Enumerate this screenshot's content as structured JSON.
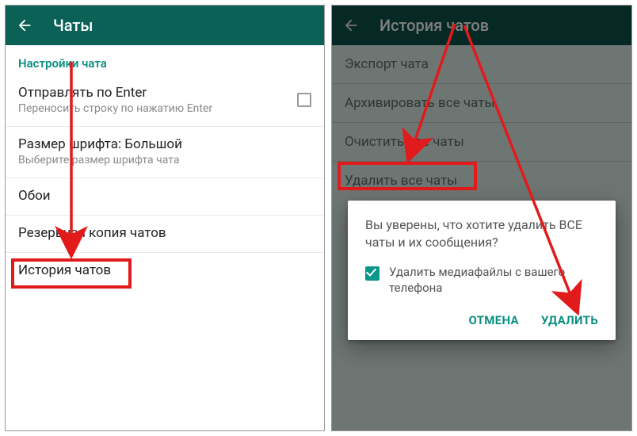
{
  "left": {
    "header_title": "Чаты",
    "section_label": "Настройки чата",
    "send_enter": {
      "title": "Отправлять по Enter",
      "subtitle": "Переносить строку по нажатию Enter",
      "checked": false
    },
    "font_size": {
      "title": "Размер шрифта: Большой",
      "subtitle": "Выберите размер шрифта чата"
    },
    "wallpaper": {
      "title": "Обои"
    },
    "backup": {
      "title": "Резервная копия чатов"
    },
    "history": {
      "title": "История чатов"
    }
  },
  "right": {
    "header_title": "История чатов",
    "export": "Экспорт чата",
    "archive_all": "Архивировать все чаты",
    "clear_all": "Очистить все чаты",
    "delete_all": "Удалить все чаты"
  },
  "dialog": {
    "message": "Вы уверены, что хотите удалить ВСЕ чаты и их сообщения?",
    "checkbox_label": "Удалить медиафайлы с вашего телефона",
    "cancel": "ОТМЕНА",
    "confirm": "УДАЛИТЬ"
  }
}
